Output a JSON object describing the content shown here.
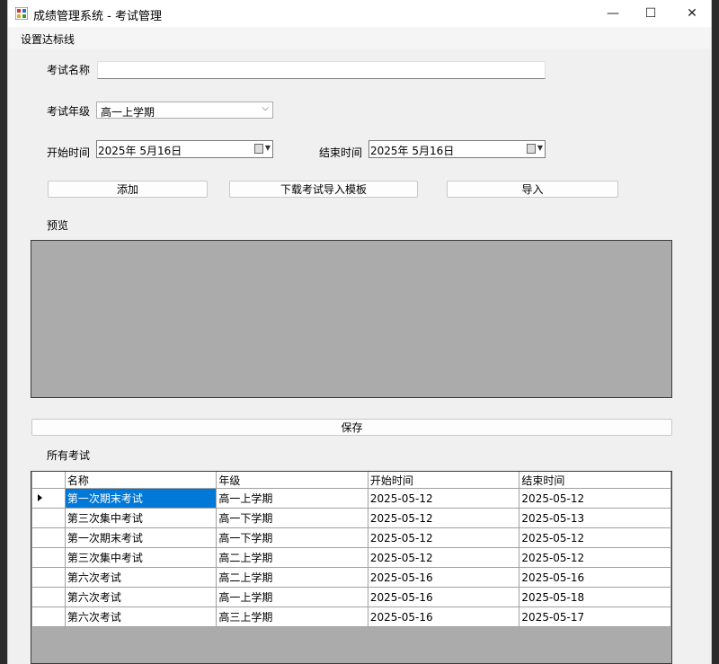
{
  "window": {
    "title": "成绩管理系统 - 考试管理",
    "min_symbol": "—",
    "max_symbol": "☐",
    "close_symbol": "✕"
  },
  "menu": {
    "item": "设置达标线"
  },
  "form": {
    "exam_name_label": "考试名称",
    "exam_name_value": "",
    "grade_label": "考试年级",
    "grade_value": "高一上学期",
    "start_label": "开始时间",
    "start_value": "2025年  5月16日",
    "end_label": "结束时间",
    "end_value": "2025年  5月16日"
  },
  "buttons": {
    "add": "添加",
    "download": "下载考试导入模板",
    "import": "导入",
    "save": "保存"
  },
  "preview_label": "预览",
  "all_exams_label": "所有考试",
  "table": {
    "headers": [
      "名称",
      "年级",
      "开始时间",
      "结束时间"
    ],
    "rows": [
      [
        "第一次期末考试",
        "高一上学期",
        "2025-05-12",
        "2025-05-12"
      ],
      [
        "第三次集中考试",
        "高一下学期",
        "2025-05-12",
        "2025-05-13"
      ],
      [
        "第一次期末考试",
        "高一下学期",
        "2025-05-12",
        "2025-05-12"
      ],
      [
        "第三次集中考试",
        "高二上学期",
        "2025-05-12",
        "2025-05-12"
      ],
      [
        "第六次考试",
        "高二上学期",
        "2025-05-16",
        "2025-05-16"
      ],
      [
        "第六次考试",
        "高一上学期",
        "2025-05-16",
        "2025-05-18"
      ],
      [
        "第六次考试",
        "高三上学期",
        "2025-05-16",
        "2025-05-17"
      ]
    ]
  }
}
